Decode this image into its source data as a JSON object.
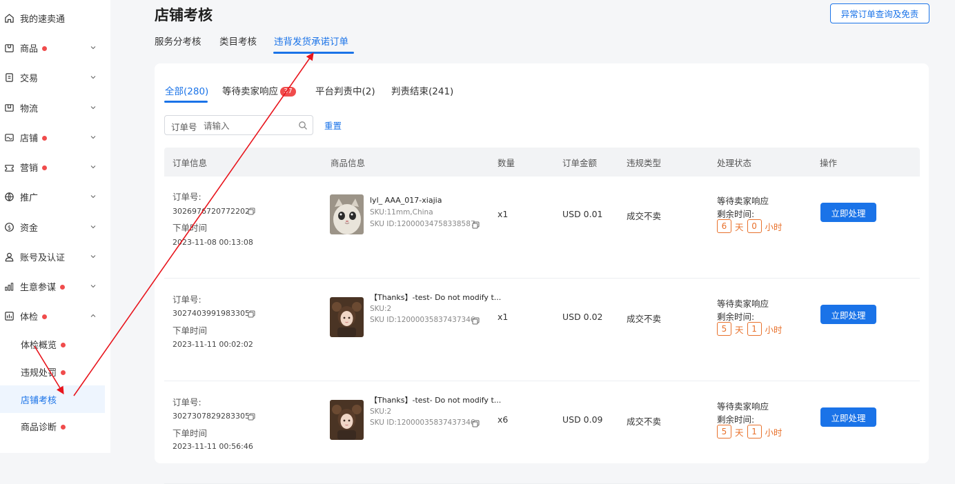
{
  "sidebar": {
    "items": [
      {
        "label": "我的速卖通",
        "icon": "home-icon",
        "dot": false,
        "chevron": ""
      },
      {
        "label": "商品",
        "icon": "product-icon",
        "dot": true,
        "chevron": "down"
      },
      {
        "label": "交易",
        "icon": "trade-icon",
        "dot": false,
        "chevron": "down"
      },
      {
        "label": "物流",
        "icon": "logistics-icon",
        "dot": false,
        "chevron": "down"
      },
      {
        "label": "店铺",
        "icon": "store-icon",
        "dot": true,
        "chevron": "down"
      },
      {
        "label": "营销",
        "icon": "marketing-icon",
        "dot": true,
        "chevron": "down"
      },
      {
        "label": "推广",
        "icon": "globe-icon",
        "dot": false,
        "chevron": "down"
      },
      {
        "label": "资金",
        "icon": "dollar-icon",
        "dot": false,
        "chevron": "down"
      },
      {
        "label": "账号及认证",
        "icon": "user-icon",
        "dot": false,
        "chevron": "down"
      },
      {
        "label": "生意参谋",
        "icon": "bar-chart-icon",
        "dot": true,
        "chevron": "down"
      },
      {
        "label": "体检",
        "icon": "checkup-icon",
        "dot": true,
        "chevron": "up"
      }
    ],
    "subitems": [
      {
        "label": "体检概览",
        "dot": true,
        "active": false
      },
      {
        "label": "违规处罚",
        "dot": true,
        "active": false
      },
      {
        "label": "店铺考核",
        "dot": false,
        "active": true
      },
      {
        "label": "商品诊断",
        "dot": true,
        "active": false
      }
    ]
  },
  "header": {
    "title": "店铺考核",
    "action_button": "异常订单查询及免责",
    "tabs": [
      "服务分考核",
      "类目考核",
      "违背发货承诺订单"
    ],
    "active_tab": 2
  },
  "filters": {
    "tabs": [
      {
        "label": "全部(280)",
        "badge": ""
      },
      {
        "label": "等待卖家响应",
        "badge": "37"
      },
      {
        "label": "平台判责中(2)",
        "badge": ""
      },
      {
        "label": "判责结束(241)",
        "badge": ""
      }
    ],
    "search_label": "订单号",
    "search_placeholder": "请输入",
    "reset_label": "重置"
  },
  "table": {
    "columns": [
      "订单信息",
      "商品信息",
      "数量",
      "订单金额",
      "违规类型",
      "处理状态",
      "操作"
    ],
    "rows": [
      {
        "order_no_label": "订单号:",
        "order_no": "3026976720772202",
        "order_time_label": "下单时间",
        "order_time": "2023-11-08 00:13:08",
        "product_title": "lyl_ AAA_017-xiajia",
        "sku": "SKU:11mm,China",
        "sku_id": "SKU ID:12000034758338587",
        "qty": "x1",
        "amount": "USD 0.01",
        "violation": "成交不卖",
        "status": "等待卖家响应",
        "remain_label": "剩余时间:",
        "days": "6",
        "day_unit": "天",
        "hours": "0",
        "hour_unit": "小时",
        "action": "立即处理",
        "thumb": "cat"
      },
      {
        "order_no_label": "订单号:",
        "order_no": "3027403991983305",
        "order_time_label": "下单时间",
        "order_time": "2023-11-11 00:02:02",
        "product_title": "【Thanks】-test- Do not modify t...",
        "sku": "SKU:2",
        "sku_id": "SKU ID:12000035837437346",
        "qty": "x1",
        "amount": "USD 0.02",
        "violation": "成交不卖",
        "status": "等待卖家响应",
        "remain_label": "剩余时间:",
        "days": "5",
        "day_unit": "天",
        "hours": "1",
        "hour_unit": "小时",
        "action": "立即处理",
        "thumb": "girl"
      },
      {
        "order_no_label": "订单号:",
        "order_no": "3027307829283305",
        "order_time_label": "下单时间",
        "order_time": "2023-11-11 00:56:46",
        "product_title": "【Thanks】-test- Do not modify t...",
        "sku": "SKU:2",
        "sku_id": "SKU ID:12000035837437346",
        "qty": "x6",
        "amount": "USD 0.09",
        "violation": "成交不卖",
        "status": "等待卖家响应",
        "remain_label": "剩余时间:",
        "days": "5",
        "day_unit": "天",
        "hours": "1",
        "hour_unit": "小时",
        "action": "立即处理",
        "thumb": "girl"
      }
    ]
  },
  "colors": {
    "accent": "#1a73e8",
    "dot": "#f04c4c",
    "countdown": "#e8702a",
    "annotation": "#e8141c"
  }
}
